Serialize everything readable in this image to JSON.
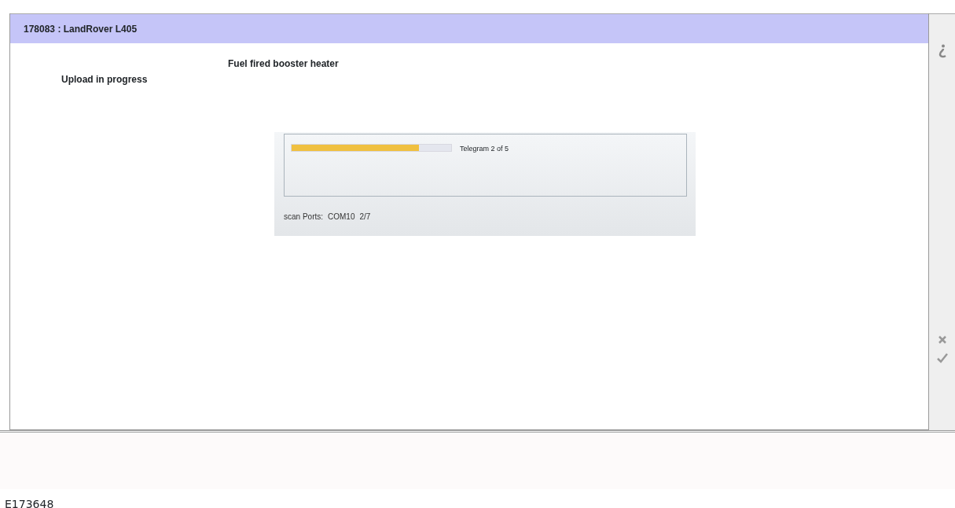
{
  "header": {
    "title": "178083 : LandRover L405"
  },
  "heading": "Fuel fired booster heater",
  "status": "Upload in progress",
  "progress_dialog": {
    "level": 0.8,
    "reading": "Telegram 2 of 5",
    "scan_label": "scan Ports:",
    "port": "COM10",
    "count": "2/7"
  },
  "figure_id": "E173648"
}
